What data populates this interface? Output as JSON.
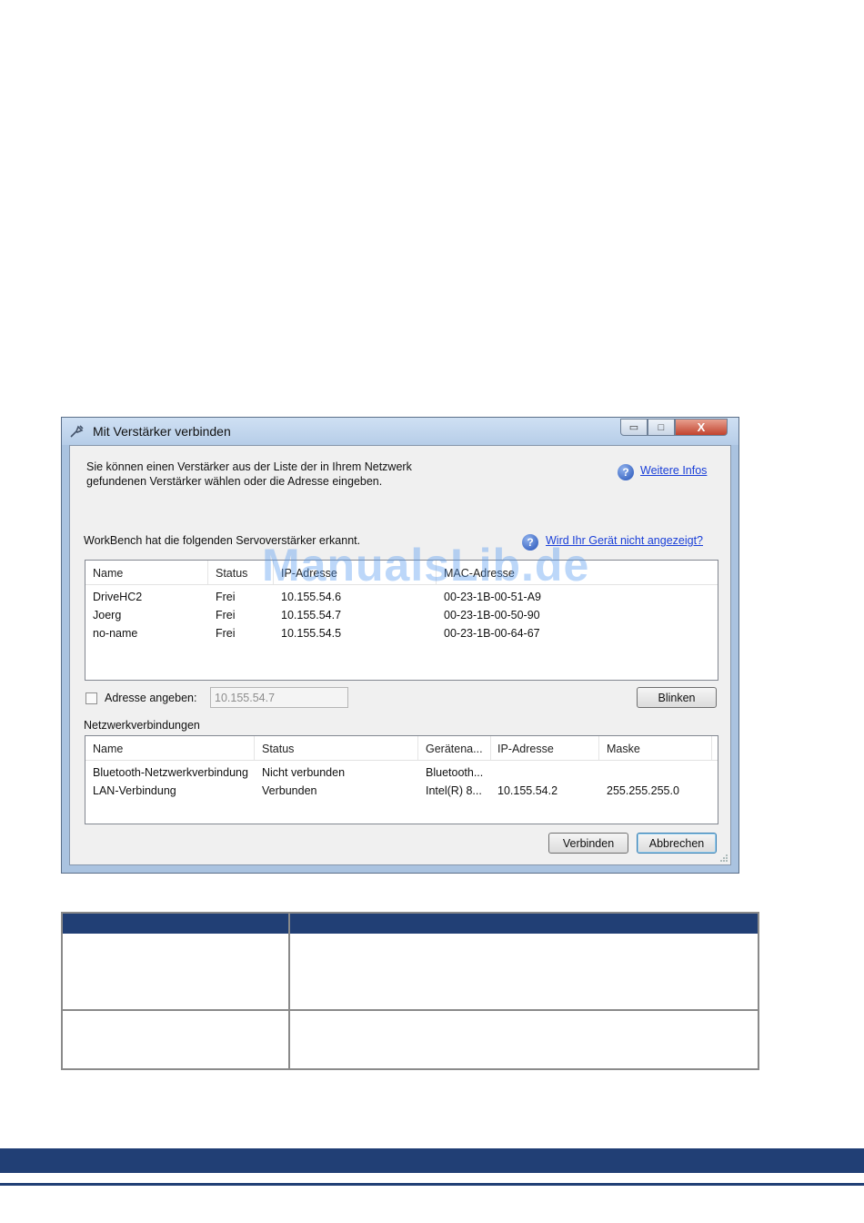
{
  "window": {
    "title": "Mit Verstärker verbinden",
    "minimize_glyph": "▭",
    "maximize_glyph": "□",
    "close_glyph": "X",
    "intro_line1": "Sie können einen Verstärker aus der Liste der in Ihrem Netzwerk",
    "intro_line2": "gefundenen Verstärker wählen oder die Adresse eingeben.",
    "more_info_link": "Weitere Infos",
    "detected_text": "WorkBench hat die folgenden Servoverstärker erkannt.",
    "not_shown_link": "Wird Ihr Gerät nicht angezeigt?"
  },
  "amplifiers": {
    "columns": [
      "Name",
      "Status",
      "IP-Adresse",
      "MAC-Adresse"
    ],
    "rows": [
      [
        "DriveHC2",
        "Frei",
        "10.155.54.6",
        "00-23-1B-00-51-A9"
      ],
      [
        "Joerg",
        "Frei",
        "10.155.54.7",
        "00-23-1B-00-50-90"
      ],
      [
        "no-name",
        "Frei",
        "10.155.54.5",
        "00-23-1B-00-64-67"
      ]
    ]
  },
  "address": {
    "checkbox_label": "Adresse angeben:",
    "value": "10.155.54.7",
    "blink_button": "Blinken"
  },
  "network": {
    "label": "Netzwerkverbindungen",
    "columns": [
      "Name",
      "Status",
      "Gerätena...",
      "IP-Adresse",
      "Maske"
    ],
    "rows": [
      [
        "Bluetooth-Netzwerkverbindung",
        "Nicht verbunden",
        "Bluetooth...",
        "",
        ""
      ],
      [
        "LAN-Verbindung",
        "Verbunden",
        "Intel(R) 8...",
        "10.155.54.2",
        "255.255.255.0"
      ]
    ]
  },
  "buttons": {
    "connect": "Verbinden",
    "cancel": "Abbrechen"
  },
  "watermark": "ManualsLib.de",
  "colors": {
    "brand_navy": "#213f75",
    "link_blue": "#1a3fd8",
    "title_bar": "#b6cde8",
    "close_red": "#c1432e"
  }
}
